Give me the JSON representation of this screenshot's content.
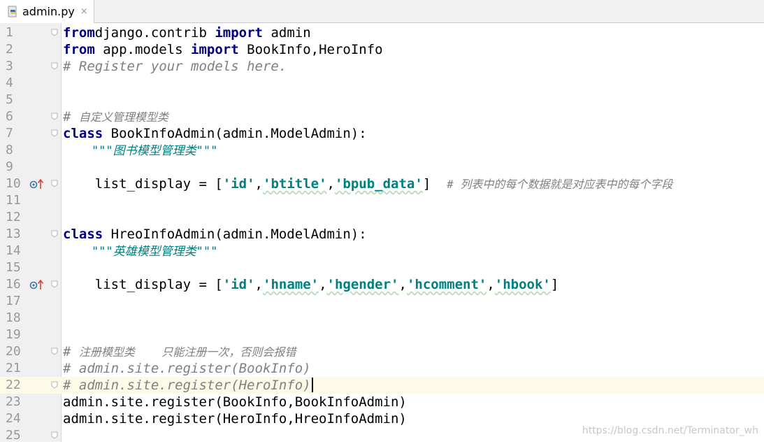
{
  "tab": {
    "filename": "admin.py",
    "close_glyph": "×",
    "icon": "python-file-icon"
  },
  "editor": {
    "current_line": 22,
    "lines": [
      {
        "n": "1",
        "fold": true,
        "mark": false,
        "tokens": [
          [
            "kw",
            "from"
          ],
          [
            "",
            "django.contrib "
          ],
          [
            "kw",
            "import"
          ],
          [
            "",
            " admin"
          ]
        ]
      },
      {
        "n": "2",
        "fold": false,
        "mark": false,
        "tokens": [
          [
            "kw",
            "from"
          ],
          [
            "",
            " app.models "
          ],
          [
            "kw",
            "import"
          ],
          [
            "",
            " BookInfo,HeroInfo"
          ]
        ]
      },
      {
        "n": "3",
        "fold": true,
        "mark": false,
        "tokens": [
          [
            "cmt",
            "# Register your models here."
          ]
        ]
      },
      {
        "n": "4",
        "fold": false,
        "mark": false,
        "tokens": []
      },
      {
        "n": "5",
        "fold": false,
        "mark": false,
        "tokens": []
      },
      {
        "n": "6",
        "fold": true,
        "mark": false,
        "tokens": [
          [
            "cmt",
            "# "
          ],
          [
            "cmt cn",
            "自定义管理模型类"
          ]
        ]
      },
      {
        "n": "7",
        "fold": true,
        "mark": false,
        "tokens": [
          [
            "kw",
            "class"
          ],
          [
            "",
            " BookInfoAdmin(admin.ModelAdmin):"
          ]
        ]
      },
      {
        "n": "8",
        "fold": false,
        "mark": false,
        "tokens": [
          [
            "doc",
            "    \"\"\"图书模型管理类\"\"\""
          ]
        ]
      },
      {
        "n": "9",
        "fold": false,
        "mark": false,
        "tokens": []
      },
      {
        "n": "10",
        "fold": true,
        "mark": true,
        "tokens": [
          [
            "",
            "    list_display = ["
          ],
          [
            "str",
            "'id'"
          ],
          [
            "",
            ","
          ],
          [
            "str squig",
            "'btitle'"
          ],
          [
            "",
            ","
          ],
          [
            "str squig",
            "'bpub_data'"
          ],
          [
            "",
            "]  "
          ],
          [
            "cmt cn",
            "# 列表中的每个数据就是对应表中的每个字段"
          ]
        ]
      },
      {
        "n": "11",
        "fold": false,
        "mark": false,
        "tokens": []
      },
      {
        "n": "12",
        "fold": false,
        "mark": false,
        "tokens": []
      },
      {
        "n": "13",
        "fold": true,
        "mark": false,
        "tokens": [
          [
            "kw",
            "class"
          ],
          [
            "",
            " HreoInfoAdmin(admin.ModelAdmin):"
          ]
        ]
      },
      {
        "n": "14",
        "fold": false,
        "mark": false,
        "tokens": [
          [
            "doc",
            "    \"\"\"英雄模型管理类\"\"\""
          ]
        ]
      },
      {
        "n": "15",
        "fold": false,
        "mark": false,
        "tokens": []
      },
      {
        "n": "16",
        "fold": true,
        "mark": true,
        "tokens": [
          [
            "",
            "    list_display = ["
          ],
          [
            "str",
            "'id'"
          ],
          [
            "",
            ","
          ],
          [
            "str squig",
            "'hname'"
          ],
          [
            "",
            ","
          ],
          [
            "str squig",
            "'hgender'"
          ],
          [
            "",
            ","
          ],
          [
            "str squig",
            "'hcomment'"
          ],
          [
            "",
            ","
          ],
          [
            "str squig",
            "'hbook'"
          ],
          [
            "",
            "]"
          ]
        ]
      },
      {
        "n": "17",
        "fold": false,
        "mark": false,
        "tokens": []
      },
      {
        "n": "18",
        "fold": false,
        "mark": false,
        "tokens": []
      },
      {
        "n": "19",
        "fold": false,
        "mark": false,
        "tokens": []
      },
      {
        "n": "20",
        "fold": true,
        "mark": false,
        "tokens": [
          [
            "cmt",
            "# "
          ],
          [
            "cmt cn",
            "注册模型类    只能注册一次，否则会报错"
          ]
        ]
      },
      {
        "n": "21",
        "fold": false,
        "mark": false,
        "tokens": [
          [
            "cmt",
            "# admin.site.register(BookInfo)"
          ]
        ]
      },
      {
        "n": "22",
        "fold": true,
        "mark": false,
        "tokens": [
          [
            "cmt",
            "# admin.site.register(HeroInfo)"
          ]
        ]
      },
      {
        "n": "23",
        "fold": false,
        "mark": false,
        "tokens": [
          [
            "",
            "admin.site.register(BookInfo,BookInfoAdmin)"
          ]
        ]
      },
      {
        "n": "24",
        "fold": false,
        "mark": false,
        "tokens": [
          [
            "",
            "admin.site.register(HeroInfo,HreoInfoAdmin)"
          ]
        ]
      },
      {
        "n": "25",
        "fold": true,
        "mark": false,
        "tokens": []
      }
    ]
  },
  "watermark": "https://blog.csdn.net/Terminator_wh",
  "colors": {
    "keyword": "#000080",
    "string": "#008080",
    "comment": "#808080",
    "current_line": "#fcfae6",
    "gutter": "#f0f0f0"
  }
}
